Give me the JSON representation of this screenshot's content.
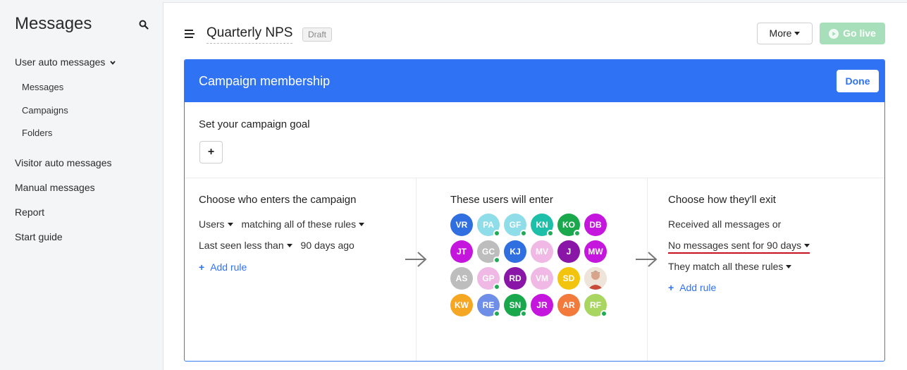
{
  "sidebar": {
    "title": "Messages",
    "items": [
      {
        "label": "User auto messages"
      },
      {
        "label": "Messages"
      },
      {
        "label": "Campaigns"
      },
      {
        "label": "Folders"
      },
      {
        "label": "Visitor auto messages"
      },
      {
        "label": "Manual messages"
      },
      {
        "label": "Report"
      },
      {
        "label": "Start guide"
      }
    ]
  },
  "header": {
    "campaign_title": "Quarterly NPS",
    "status_badge": "Draft",
    "more_label": "More",
    "go_live_label": "Go live"
  },
  "card": {
    "title": "Campaign membership",
    "done_label": "Done",
    "goal_label": "Set your campaign goal",
    "goal_add_label": "+"
  },
  "enter": {
    "title": "Choose who enters the campaign",
    "audience": "Users",
    "matching": "matching all of these rules",
    "rule_field": "Last seen less than",
    "rule_value": "90 days ago",
    "add_rule": "Add rule"
  },
  "users": {
    "title": "These users will enter",
    "avatars": [
      {
        "initials": "VR",
        "color": "#2f6fe0",
        "online": false
      },
      {
        "initials": "PA",
        "color": "#8fdde8",
        "online": true
      },
      {
        "initials": "GF",
        "color": "#8fdde8",
        "online": true
      },
      {
        "initials": "KN",
        "color": "#1ebfa8",
        "online": true
      },
      {
        "initials": "KO",
        "color": "#1aa84c",
        "online": true
      },
      {
        "initials": "DB",
        "color": "#c516dd",
        "online": false
      },
      {
        "initials": "JT",
        "color": "#c516dd",
        "online": false
      },
      {
        "initials": "GC",
        "color": "#bdbdbd",
        "online": true
      },
      {
        "initials": "KJ",
        "color": "#2f6fe0",
        "online": false
      },
      {
        "initials": "MV",
        "color": "#f0b8e4",
        "online": false
      },
      {
        "initials": "J",
        "color": "#8a16a8",
        "online": false
      },
      {
        "initials": "MW",
        "color": "#c516dd",
        "online": false
      },
      {
        "initials": "AS",
        "color": "#bdbdbd",
        "online": false
      },
      {
        "initials": "GP",
        "color": "#f0b8e4",
        "online": true
      },
      {
        "initials": "RD",
        "color": "#8a16a8",
        "online": false
      },
      {
        "initials": "VM",
        "color": "#f0b8e4",
        "online": false
      },
      {
        "initials": "SD",
        "color": "#f2c40e",
        "online": false
      },
      {
        "initials": "",
        "color": "#e9dcd2",
        "online": false,
        "photo": true
      },
      {
        "initials": "KW",
        "color": "#f5a623",
        "online": false
      },
      {
        "initials": "RE",
        "color": "#6f8ee8",
        "online": true
      },
      {
        "initials": "SN",
        "color": "#1aa84c",
        "online": true
      },
      {
        "initials": "JR",
        "color": "#c516dd",
        "online": false
      },
      {
        "initials": "AR",
        "color": "#f27a3a",
        "online": false
      },
      {
        "initials": "RF",
        "color": "#a9d660",
        "online": true
      }
    ]
  },
  "exit": {
    "title": "Choose how they'll exit",
    "received": "Received all messages or",
    "no_messages": "No messages sent for 90 days",
    "match": "They match all these rules",
    "add_rule": "Add rule"
  },
  "colors": {
    "accent": "#2f72f4",
    "go_live": "#a6dfb9",
    "online_dot": "#1faa56",
    "underline": "#c6121f"
  }
}
